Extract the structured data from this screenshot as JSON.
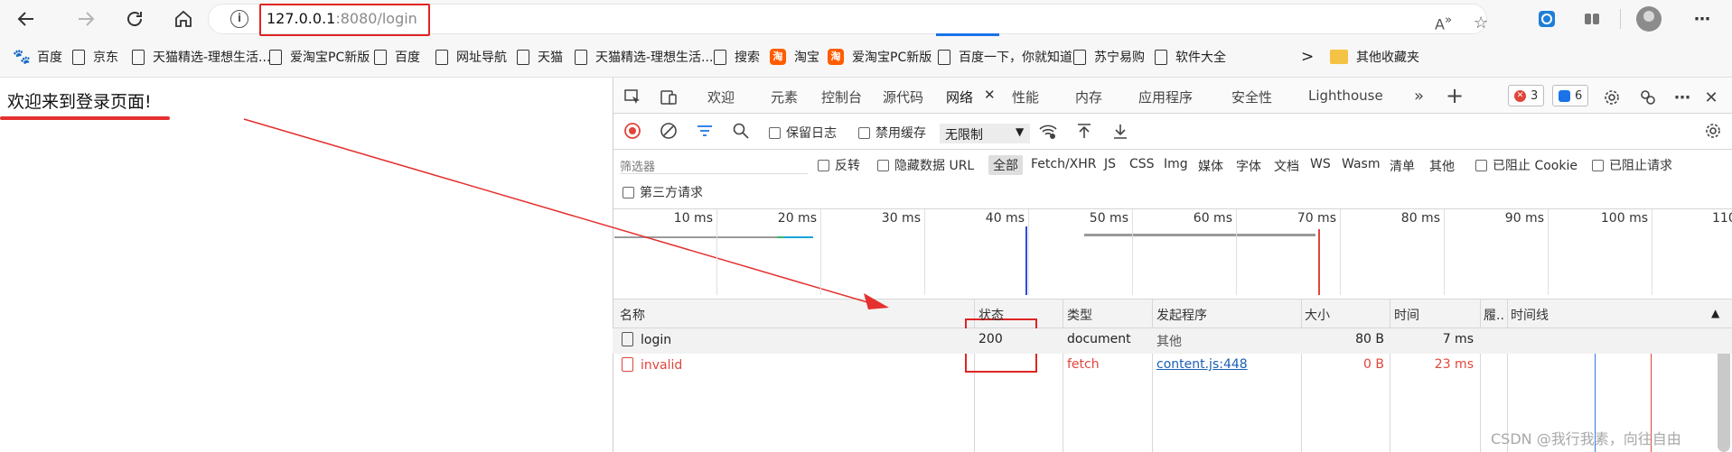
{
  "browser": {
    "address": {
      "host": "127.0.0.1",
      "rest": ":8080/login"
    },
    "icons": {
      "back": "back-arrow-icon",
      "forward": "forward-arrow-icon",
      "refresh": "refresh-icon",
      "home": "home-icon"
    }
  },
  "bookmarks": [
    {
      "label": "百度",
      "icon": "paw"
    },
    {
      "label": "京东",
      "icon": "page"
    },
    {
      "label": "天猫精选-理想生活...",
      "icon": "page"
    },
    {
      "label": "爱淘宝PC新版",
      "icon": "page"
    },
    {
      "label": "百度",
      "icon": "page"
    },
    {
      "label": "网址导航",
      "icon": "page"
    },
    {
      "label": "天猫",
      "icon": "page"
    },
    {
      "label": "天猫精选-理想生活...",
      "icon": "page"
    },
    {
      "label": "搜索",
      "icon": "page"
    },
    {
      "label": "淘宝",
      "icon": "tao"
    },
    {
      "label": "爱淘宝PC新版",
      "icon": "tao"
    },
    {
      "label": "百度一下，你就知道",
      "icon": "page"
    },
    {
      "label": "苏宁易购",
      "icon": "page"
    },
    {
      "label": "软件大全",
      "icon": "page"
    }
  ],
  "bookmarks_more": ">",
  "other_bookmarks": "其他收藏夹",
  "tao_glyph": "淘",
  "page": {
    "welcome": "欢迎来到登录页面!"
  },
  "devtools": {
    "tabs": [
      "欢迎",
      "元素",
      "控制台",
      "源代码",
      "网络",
      "性能",
      "内存",
      "应用程序",
      "安全性",
      "Lighthouse"
    ],
    "active_tab": "网络",
    "more_tabs": "»",
    "add_tab": "+",
    "errors": "3",
    "messages": "6",
    "toolbar": {
      "preserve_log": "保留日志",
      "disable_cache": "禁用缓存",
      "throttle": "无限制"
    },
    "filter": {
      "placeholder": "筛选器",
      "invert": "反转",
      "hide_data_urls": "隐藏数据 URL",
      "types": [
        "全部",
        "Fetch/XHR",
        "JS",
        "CSS",
        "Img",
        "媒体",
        "字体",
        "文档",
        "WS",
        "Wasm",
        "清单",
        "其他"
      ],
      "blocked_cookies": "已阻止 Cookie",
      "blocked_requests": "已阻止请求",
      "third_party": "第三方请求"
    },
    "ticks": [
      "10 ms",
      "20 ms",
      "30 ms",
      "40 ms",
      "50 ms",
      "60 ms",
      "70 ms",
      "80 ms",
      "90 ms",
      "100 ms",
      "110"
    ],
    "columns": {
      "name": "名称",
      "status": "状态",
      "type": "类型",
      "initiator": "发起程序",
      "size": "大小",
      "time": "时间",
      "fulfilled": "履..",
      "waterfall": "时间线"
    },
    "rows": [
      {
        "name": "login",
        "status": "200",
        "type": "document",
        "initiator": "其他",
        "size": "80 B",
        "time": "7 ms"
      },
      {
        "name": "invalid",
        "status": "",
        "type": "fetch",
        "initiator": "content.js:448",
        "size": "0 B",
        "time": "23 ms"
      }
    ]
  },
  "watermark": "CSDN @我行我素，向往自由",
  "colors": {
    "annotation_red": "#e02424",
    "error_red": "#e0463b",
    "link_blue": "#1a5fb4",
    "accent_blue": "#1a73e8"
  }
}
